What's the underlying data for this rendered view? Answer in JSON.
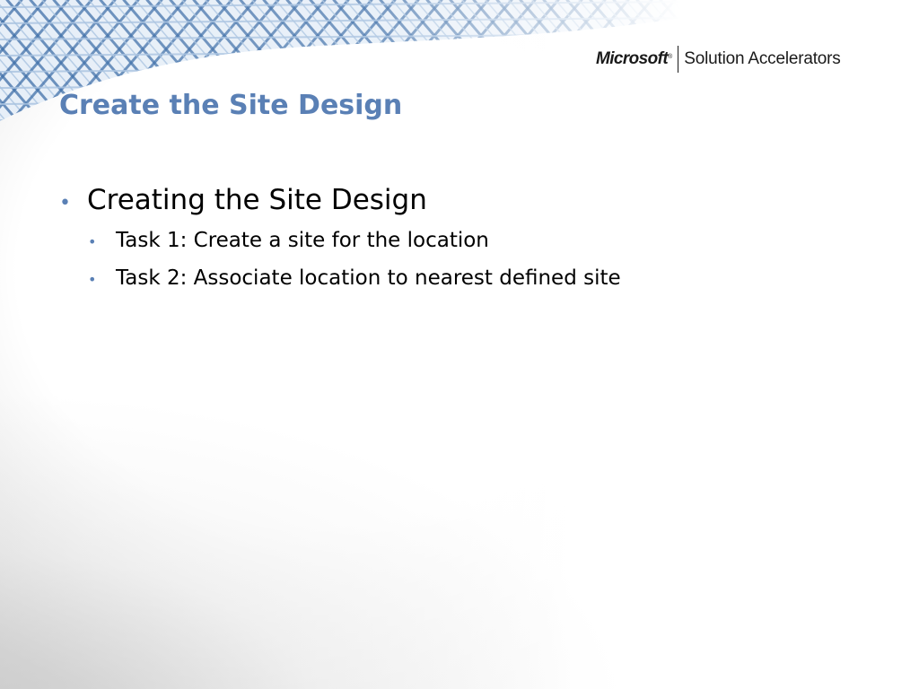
{
  "slide": {
    "title": "Create the Site Design",
    "logo": {
      "brand": "Microsoft",
      "trademark": "®",
      "product": "Solution Accelerators"
    },
    "bullets": [
      {
        "text": "Creating the Site Design",
        "children": [
          {
            "text": "Task 1: Create a site for the location"
          },
          {
            "text": "Task 2: Associate location to nearest defined site"
          }
        ]
      }
    ],
    "bullet_glyph": "•"
  },
  "colors": {
    "title": "#5a80b5",
    "bullet": "#5a80b5",
    "body_text": "#000000",
    "lattice_dark": "#3f6fa8",
    "lattice_light": "#a9c3e0"
  },
  "decoration": {
    "lattice": "blue-steel-lattice-graphic"
  }
}
